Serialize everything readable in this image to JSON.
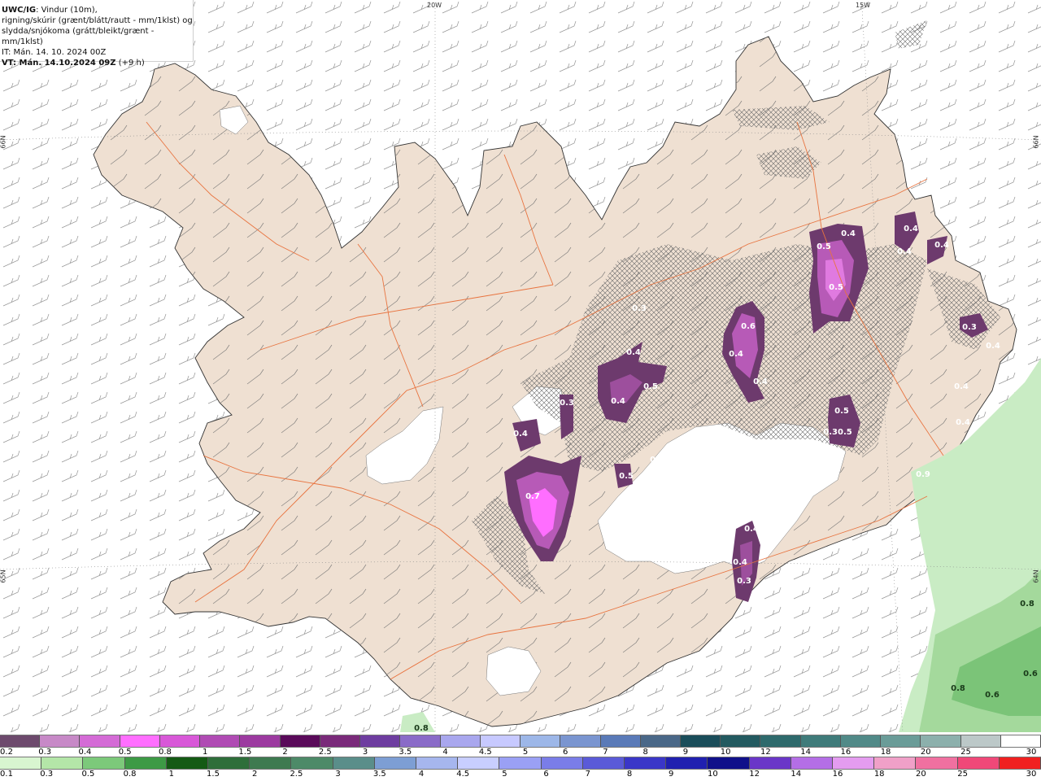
{
  "header": {
    "title_bold": "UWC/IG",
    "title_rest": ": Vindur (10m),",
    "line2": "rigning/skúrir (grænt/blátt/rautt - mm/1klst) og",
    "line3": "slydda/snjókoma (grátt/bleikt/grænt - mm/1klst)",
    "line4": "IT: Mán. 14. 10. 2024 00Z",
    "line5_bold": "VT: Mán. 14.10.2024 09Z",
    "line5_rest": " (+9 h)"
  },
  "grid_labels": {
    "lon_20w": "20W",
    "lon_15w": "15W",
    "lat_66n_left": "66N",
    "lat_66n_right": "66N",
    "lat_65n_left": "65N",
    "lat_64n_right": "64N"
  },
  "map_labels": {
    "snow": [
      {
        "text": "0.5"
      },
      {
        "text": "0.4"
      },
      {
        "text": "0.4"
      },
      {
        "text": "0.4"
      },
      {
        "text": "0.4"
      },
      {
        "text": "0.5"
      },
      {
        "text": "0.4"
      },
      {
        "text": "0.6"
      },
      {
        "text": "0.4"
      },
      {
        "text": "0.4"
      },
      {
        "text": "0.5"
      },
      {
        "text": "0.4"
      },
      {
        "text": "0.5"
      },
      {
        "text": "0.7"
      },
      {
        "text": "0.3"
      },
      {
        "text": "0.3"
      },
      {
        "text": "0.4"
      },
      {
        "text": "0.5"
      },
      {
        "text": "0.3"
      },
      {
        "text": "0.30.5"
      },
      {
        "text": "0.4"
      },
      {
        "text": "0.4"
      },
      {
        "text": "0.4"
      },
      {
        "text": "0.3"
      },
      {
        "text": "0.4"
      },
      {
        "text": "0.4"
      },
      {
        "text": "0.9"
      },
      {
        "text": "0.3"
      }
    ],
    "rain": [
      {
        "text": "0.8"
      },
      {
        "text": "0.6"
      },
      {
        "text": "0.8"
      },
      {
        "text": "0.6"
      },
      {
        "text": "0.8"
      }
    ]
  },
  "legend": {
    "top_colors": [
      "#6d4a6d",
      "#c789c7",
      "#d46bd6",
      "#ff6eff",
      "#d858d8",
      "#b04bb4",
      "#9c3aa0",
      "#5a0a5a",
      "#7a2a7a",
      "#6e3da0",
      "#8a6bc8",
      "#a9a7ee",
      "#c7c9ff",
      "#9db7e8",
      "#7a95d0",
      "#5a7ab8",
      "#4a6888",
      "#1a4d5a",
      "#235a60",
      "#2e6a6c",
      "#3f7b7a",
      "#518a88",
      "#6a9c98",
      "#8cb0ac",
      "#bcc8c8",
      "#ffffff"
    ],
    "top_ticks": [
      "0.2",
      "0.3",
      "0.4",
      "0.5",
      "0.8",
      "1",
      "1.5",
      "2",
      "2.5",
      "3",
      "3.5",
      "4",
      "4.5",
      "5",
      "6",
      "7",
      "8",
      "9",
      "10",
      "12",
      "14",
      "16",
      "18",
      "20",
      "25",
      "30"
    ],
    "bottom_colors": [
      "#d8f5d0",
      "#b4e6a8",
      "#7cc97a",
      "#3d9a45",
      "#145a14",
      "#2e6e3a",
      "#3e7a50",
      "#4d8a68",
      "#5a8e8a",
      "#7d9ed4",
      "#a6b6ee",
      "#c8ceff",
      "#9aa0f5",
      "#7a7de8",
      "#5a5ad8",
      "#3a36c8",
      "#2020b0",
      "#10108a",
      "#6a36c8",
      "#b46ee6",
      "#e49cf0",
      "#f0a0c8",
      "#f070a0",
      "#f04878",
      "#f02020"
    ],
    "bottom_ticks": [
      "0.1",
      "0.3",
      "0.5",
      "0.8",
      "1",
      "1.5",
      "2",
      "2.5",
      "3",
      "3.5",
      "4",
      "4.5",
      "5",
      "6",
      "7",
      "8",
      "9",
      "10",
      "12",
      "14",
      "16",
      "18",
      "20",
      "25",
      "30"
    ]
  }
}
